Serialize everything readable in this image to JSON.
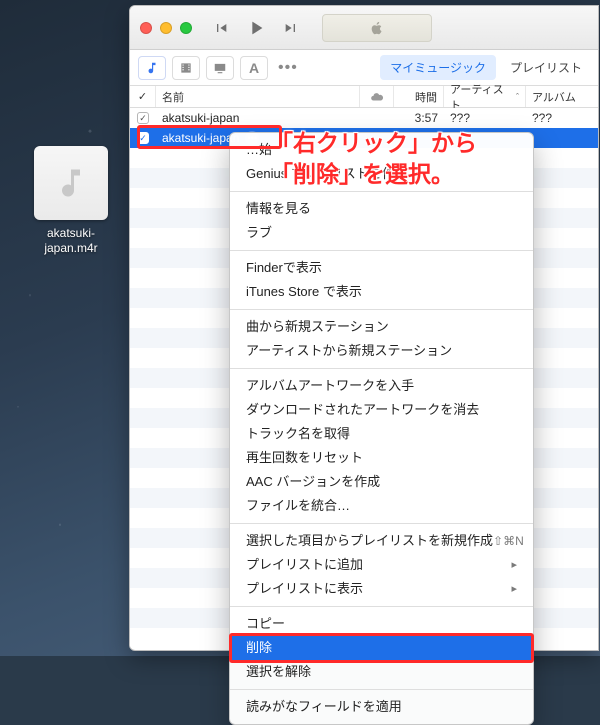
{
  "desktop_icon": {
    "label": "akatsuki-japan.m4r"
  },
  "toolbar": {
    "tabs": {
      "my_music": "マイミュージック",
      "playlists": "プレイリスト"
    }
  },
  "columns": {
    "name": "名前",
    "time": "時間",
    "artist": "アーティスト",
    "album": "アルバム"
  },
  "rows": [
    {
      "name": "akatsuki-japan",
      "time": "3:57",
      "artist": "???",
      "album": "???"
    },
    {
      "name": "akatsuki-japan",
      "time": "",
      "artist": "",
      "album": ""
    }
  ],
  "context_menu": {
    "groups": [
      [
        {
          "label": "…始",
          "shortcut": ""
        },
        {
          "label": "Genius プレイリストを作成"
        }
      ],
      [
        {
          "label": "情報を見る"
        },
        {
          "label": "ラブ"
        }
      ],
      [
        {
          "label": "Finderで表示"
        },
        {
          "label": "iTunes Store で表示"
        }
      ],
      [
        {
          "label": "曲から新規ステーション"
        },
        {
          "label": "アーティストから新規ステーション"
        }
      ],
      [
        {
          "label": "アルバムアートワークを入手"
        },
        {
          "label": "ダウンロードされたアートワークを消去"
        },
        {
          "label": "トラック名を取得"
        },
        {
          "label": "再生回数をリセット"
        },
        {
          "label": "AAC バージョンを作成"
        },
        {
          "label": "ファイルを統合…"
        }
      ],
      [
        {
          "label": "選択した項目からプレイリストを新規作成",
          "shortcut": "⇧⌘N"
        },
        {
          "label": "プレイリストに追加",
          "hassub": true
        },
        {
          "label": "プレイリストに表示",
          "hassub": true
        }
      ],
      [
        {
          "label": "コピー"
        },
        {
          "label": "削除",
          "highlight": true
        },
        {
          "label": "選択を解除"
        }
      ],
      [
        {
          "label": "読みがなフィールドを適用"
        }
      ]
    ]
  },
  "annotation": {
    "line1": "「右クリック」から",
    "line2": "「削除」を選択。"
  }
}
